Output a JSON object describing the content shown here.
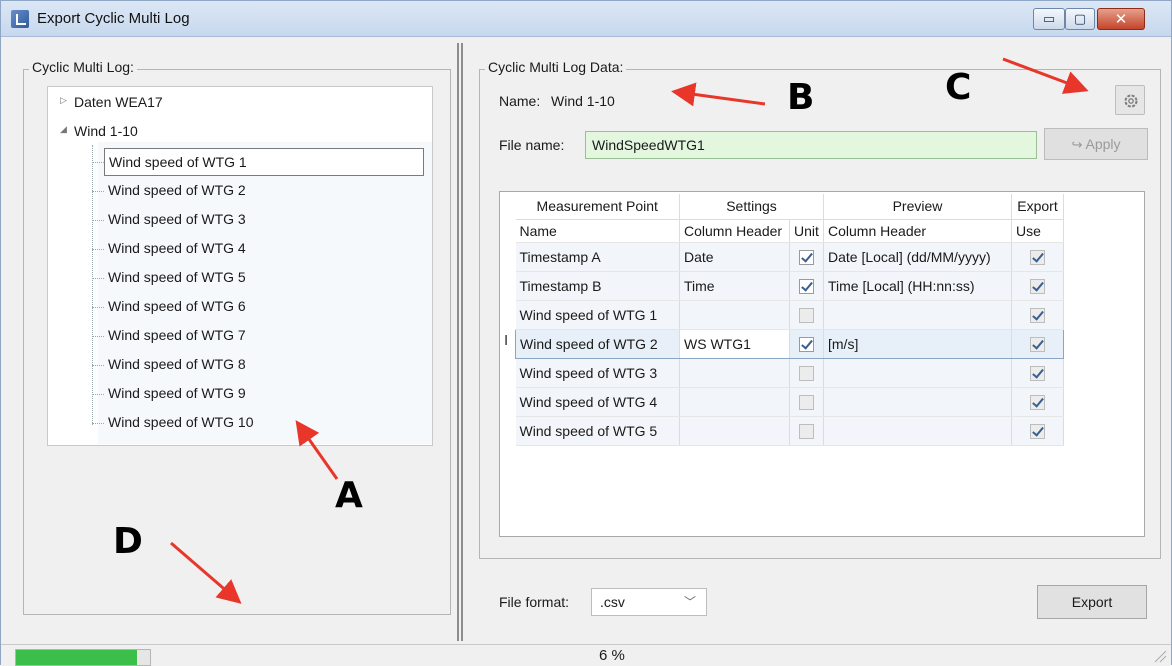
{
  "window": {
    "title": "Export Cyclic Multi Log",
    "min_glyph": "▭",
    "max_glyph": "▢",
    "close_glyph": "✕"
  },
  "left": {
    "group_title": "Cyclic Multi Log:",
    "tree": {
      "nodes": [
        {
          "label": "Daten WEA17",
          "expanded": false
        },
        {
          "label": "Wind 1-10",
          "expanded": true
        }
      ],
      "children": [
        "Wind speed of WTG 1",
        "Wind speed of WTG 2",
        "Wind speed of WTG 3",
        "Wind speed of WTG 4",
        "Wind speed of WTG 5",
        "Wind speed of WTG 6",
        "Wind speed of WTG 7",
        "Wind speed of WTG 8",
        "Wind speed of WTG 9",
        "Wind speed of WTG 10"
      ],
      "selected_child": "Wind speed of WTG 1"
    }
  },
  "right": {
    "group_title": "Cyclic Multi Log Data:",
    "name_label": "Name:",
    "name_value": "Wind 1-10",
    "file_name_label": "File name:",
    "file_name_value": "WindSpeedWTG1",
    "apply_label": "Apply",
    "grid": {
      "group_headers": [
        "Measurement Point",
        "Settings",
        "Preview",
        "Export"
      ],
      "column_headers": [
        "Name",
        "Column Header",
        "Unit",
        "Column Header",
        "Use"
      ],
      "rows": [
        {
          "name": "Timestamp A",
          "column_header": "Date",
          "unit": true,
          "preview": "Date [Local] (dd/MM/yyyy)",
          "use": true
        },
        {
          "name": "Timestamp B",
          "column_header": "Time",
          "unit": true,
          "preview": "Time [Local] (HH:nn:ss)",
          "use": true
        },
        {
          "name": "Wind speed of WTG 1",
          "column_header": "",
          "unit": false,
          "preview": "",
          "use": true
        },
        {
          "name": "Wind speed of WTG 2",
          "column_header": "WS WTG1",
          "unit": true,
          "preview": "[m/s]",
          "use": true
        },
        {
          "name": "Wind speed of WTG 3",
          "column_header": "",
          "unit": false,
          "preview": "",
          "use": true
        },
        {
          "name": "Wind speed of WTG 4",
          "column_header": "",
          "unit": false,
          "preview": "",
          "use": true
        },
        {
          "name": "Wind speed of WTG 5",
          "column_header": "",
          "unit": false,
          "preview": "",
          "use": true
        }
      ],
      "selected_row": 3
    },
    "file_format_label": "File format:",
    "file_format_value": ".csv",
    "export_label": "Export"
  },
  "status": {
    "progress": 0.06,
    "percent_text": "6 %",
    "progress_color": "#3bbf4a"
  },
  "annotations": {
    "letters": [
      "A",
      "B",
      "C",
      "D"
    ],
    "arrow_color": "#e8362b"
  },
  "colors": {
    "file_input_bg": "#e3f7df",
    "selection_border": "#8aa6c4"
  }
}
